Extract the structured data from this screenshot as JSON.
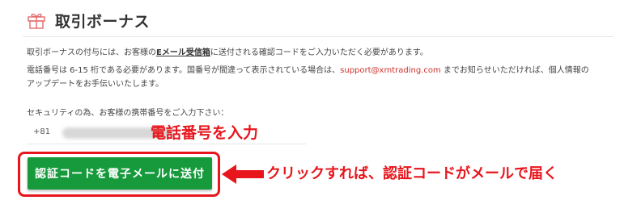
{
  "header": {
    "icon": "gift-icon",
    "title": "取引ボーナス"
  },
  "intro": {
    "before": "取引ボーナスの付与には、お客様の",
    "strong": "Eメール受信箱",
    "after": "に送付される確認コードをご入力いただく必要があります。"
  },
  "phone_note": {
    "before": "電話番号は 6-15 桁である必要があります。国番号が間違って表示されている場合は、",
    "email": "support@xmtrading.com",
    "after": " までお知らせいただければ、個人情報のアップデートをお手伝いいたします。"
  },
  "form": {
    "label": "セキュリティの為、お客様の携帯番号をご入力下さい：",
    "country_code": "+81",
    "phone_value": ""
  },
  "button": {
    "label": "認証コードを電子メールに送付"
  },
  "annotations": {
    "phone_hint": "電話番号を入力",
    "click_hint": "クリックすれば、認証コードがメールで届く"
  },
  "colors": {
    "accent_red": "#e8151c",
    "button_green": "#169a3c",
    "link_red": "#d0312d"
  }
}
